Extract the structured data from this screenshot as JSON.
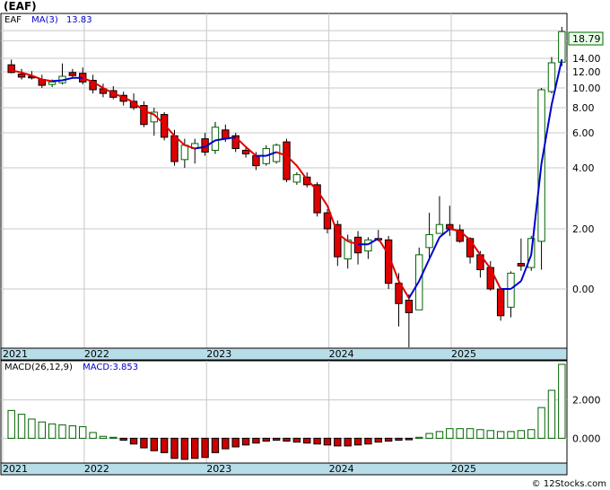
{
  "ticker": "(EAF)",
  "footer": "© 12Stocks.com",
  "colors": {
    "up": "#006400",
    "down": "#e00000",
    "ma_red": "#e00000",
    "ma_blue": "#0000cc",
    "axis_band": "#b7dde8",
    "grid": "#c8c8c8",
    "macd_up": "#006400",
    "macd_down": "#cc0000"
  },
  "chart_data": [
    {
      "type": "candlestick",
      "legend": {
        "symbol": "EAF",
        "ma_label": "MA(3)",
        "ma_value": "13.83"
      },
      "last_price_label": "18.79",
      "ylabels": [
        "14.00",
        "12.00",
        "10.00",
        "8.00",
        "6.00",
        "4.00",
        "2.00",
        "0.00"
      ],
      "xlabels": [
        "2021",
        "2022",
        "2023",
        "2024",
        "2025"
      ],
      "scale": "log",
      "candles": [
        {
          "o": 13.0,
          "h": 13.8,
          "l": 11.8,
          "c": 11.9
        },
        {
          "o": 11.7,
          "h": 12.4,
          "l": 11.0,
          "c": 11.3
        },
        {
          "o": 11.4,
          "h": 12.1,
          "l": 11.0,
          "c": 11.2
        },
        {
          "o": 11.0,
          "h": 11.6,
          "l": 10.0,
          "c": 10.3
        },
        {
          "o": 10.4,
          "h": 11.0,
          "l": 10.1,
          "c": 10.7
        },
        {
          "o": 10.6,
          "h": 13.2,
          "l": 10.4,
          "c": 11.4
        },
        {
          "o": 11.9,
          "h": 12.4,
          "l": 11.2,
          "c": 11.5
        },
        {
          "o": 11.8,
          "h": 12.6,
          "l": 10.4,
          "c": 10.7
        },
        {
          "o": 10.9,
          "h": 11.6,
          "l": 9.4,
          "c": 9.8
        },
        {
          "o": 9.9,
          "h": 10.5,
          "l": 9.0,
          "c": 9.4
        },
        {
          "o": 9.7,
          "h": 10.2,
          "l": 8.8,
          "c": 9.0
        },
        {
          "o": 9.2,
          "h": 9.6,
          "l": 8.2,
          "c": 8.6
        },
        {
          "o": 8.6,
          "h": 9.4,
          "l": 7.8,
          "c": 8.0
        },
        {
          "o": 8.2,
          "h": 8.6,
          "l": 6.4,
          "c": 6.6
        },
        {
          "o": 6.8,
          "h": 8.0,
          "l": 5.8,
          "c": 7.6
        },
        {
          "o": 7.4,
          "h": 7.6,
          "l": 5.5,
          "c": 5.7
        },
        {
          "o": 5.8,
          "h": 6.2,
          "l": 4.1,
          "c": 4.3
        },
        {
          "o": 4.4,
          "h": 5.6,
          "l": 4.0,
          "c": 5.2
        },
        {
          "o": 5.0,
          "h": 5.6,
          "l": 4.2,
          "c": 5.3
        },
        {
          "o": 5.6,
          "h": 6.0,
          "l": 4.6,
          "c": 4.8
        },
        {
          "o": 4.9,
          "h": 6.8,
          "l": 4.7,
          "c": 6.4
        },
        {
          "o": 6.2,
          "h": 6.6,
          "l": 5.4,
          "c": 5.6
        },
        {
          "o": 5.8,
          "h": 6.0,
          "l": 4.8,
          "c": 5.0
        },
        {
          "o": 4.9,
          "h": 5.1,
          "l": 4.5,
          "c": 4.7
        },
        {
          "o": 4.6,
          "h": 4.8,
          "l": 3.9,
          "c": 4.1
        },
        {
          "o": 4.2,
          "h": 5.2,
          "l": 4.1,
          "c": 5.0
        },
        {
          "o": 4.3,
          "h": 5.3,
          "l": 4.2,
          "c": 5.2
        },
        {
          "o": 5.4,
          "h": 5.6,
          "l": 3.4,
          "c": 3.5
        },
        {
          "o": 3.4,
          "h": 3.8,
          "l": 3.3,
          "c": 3.7
        },
        {
          "o": 3.6,
          "h": 3.8,
          "l": 3.2,
          "c": 3.3
        },
        {
          "o": 3.3,
          "h": 3.4,
          "l": 2.3,
          "c": 2.4
        },
        {
          "o": 2.4,
          "h": 2.5,
          "l": 1.8,
          "c": 2.0
        },
        {
          "o": 2.1,
          "h": 2.2,
          "l": 0.85,
          "c": 1.05
        },
        {
          "o": 1.0,
          "h": 1.75,
          "l": 0.8,
          "c": 1.55
        },
        {
          "o": 1.65,
          "h": 1.9,
          "l": 0.88,
          "c": 1.15
        },
        {
          "o": 1.2,
          "h": 1.65,
          "l": 1.0,
          "c": 1.55
        },
        {
          "o": 1.6,
          "h": 1.95,
          "l": 1.5,
          "c": 1.55
        },
        {
          "o": 1.55,
          "h": 1.7,
          "l": 0.5,
          "c": 0.57
        },
        {
          "o": 0.57,
          "h": 0.72,
          "l": 0.2,
          "c": 0.35
        },
        {
          "o": 0.38,
          "h": 0.44,
          "l": 0.12,
          "c": 0.28
        },
        {
          "o": 0.3,
          "h": 1.3,
          "l": 0.3,
          "c": 1.1
        },
        {
          "o": 1.3,
          "h": 2.4,
          "l": 1.0,
          "c": 1.75
        },
        {
          "o": 1.8,
          "h": 2.9,
          "l": 1.8,
          "c": 2.1
        },
        {
          "o": 2.1,
          "h": 2.6,
          "l": 1.7,
          "c": 2.0
        },
        {
          "o": 1.95,
          "h": 2.1,
          "l": 1.45,
          "c": 1.5
        },
        {
          "o": 1.6,
          "h": 1.65,
          "l": 0.9,
          "c": 1.05
        },
        {
          "o": 1.1,
          "h": 1.2,
          "l": 0.65,
          "c": 0.78
        },
        {
          "o": 0.82,
          "h": 0.95,
          "l": 0.48,
          "c": 0.5
        },
        {
          "o": 0.5,
          "h": 0.52,
          "l": 0.23,
          "c": 0.26
        },
        {
          "o": 0.32,
          "h": 0.75,
          "l": 0.25,
          "c": 0.72
        },
        {
          "o": 0.9,
          "h": 1.6,
          "l": 0.76,
          "c": 0.85
        },
        {
          "o": 0.82,
          "h": 1.7,
          "l": 0.76,
          "c": 1.6
        },
        {
          "o": 1.5,
          "h": 10.0,
          "l": 0.78,
          "c": 9.8
        },
        {
          "o": 9.6,
          "h": 14.2,
          "l": 9.4,
          "c": 13.3
        },
        {
          "o": 13.4,
          "h": 19.8,
          "l": 12.8,
          "c": 18.79
        }
      ],
      "ma": [
        12.2,
        11.9,
        11.5,
        11.0,
        10.8,
        10.9,
        11.2,
        11.2,
        10.7,
        10.0,
        9.4,
        9.0,
        8.5,
        7.7,
        7.4,
        6.6,
        5.8,
        5.2,
        5.0,
        5.1,
        5.5,
        5.6,
        5.7,
        5.1,
        4.6,
        4.6,
        4.8,
        4.6,
        4.1,
        3.5,
        3.1,
        2.6,
        1.8,
        1.5,
        1.4,
        1.4,
        1.6,
        1.1,
        0.6,
        0.4,
        0.6,
        1.0,
        1.65,
        2.0,
        1.9,
        1.55,
        1.1,
        0.8,
        0.5,
        0.5,
        0.6,
        1.1,
        4.2,
        8.3,
        13.83
      ]
    },
    {
      "type": "bar",
      "legend": {
        "label": "MACD(26,12,9)",
        "value_label": "MACD:3.853"
      },
      "ylabels": [
        "2.000",
        "0.000"
      ],
      "xlabels": [
        "2021",
        "2022",
        "2023",
        "2024",
        "2025"
      ],
      "values": [
        1.45,
        1.25,
        1.0,
        0.85,
        0.75,
        0.7,
        0.65,
        0.6,
        0.3,
        0.1,
        0.05,
        -0.1,
        -0.3,
        -0.5,
        -0.65,
        -0.75,
        -1.05,
        -1.1,
        -1.05,
        -1.0,
        -0.75,
        -0.55,
        -0.45,
        -0.35,
        -0.25,
        -0.15,
        -0.1,
        -0.15,
        -0.2,
        -0.25,
        -0.3,
        -0.35,
        -0.4,
        -0.4,
        -0.35,
        -0.3,
        -0.2,
        -0.15,
        -0.1,
        -0.08,
        0.05,
        0.25,
        0.35,
        0.5,
        0.5,
        0.5,
        0.45,
        0.4,
        0.35,
        0.35,
        0.4,
        0.45,
        1.6,
        2.5,
        3.853
      ],
      "ylim": [
        -1.2,
        3.9
      ]
    }
  ]
}
